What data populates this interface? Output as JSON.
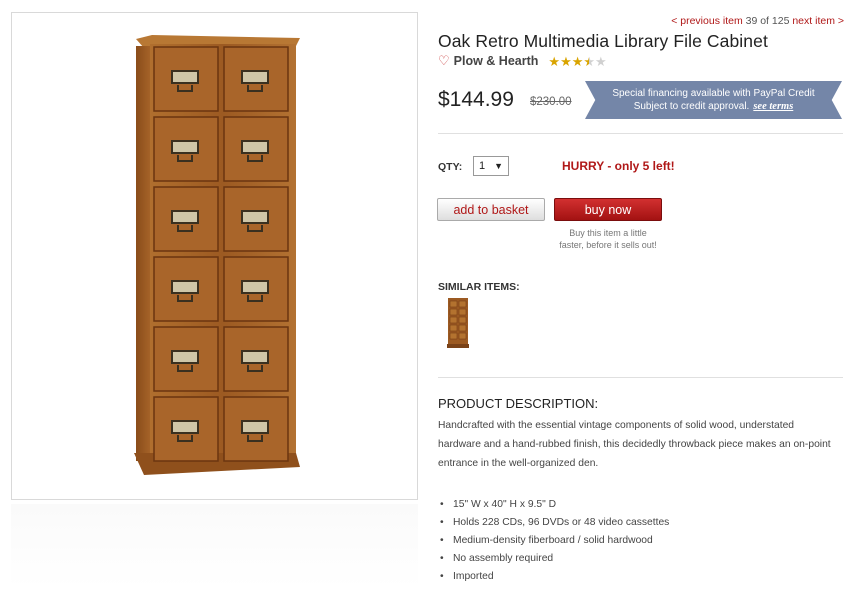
{
  "navigation": {
    "previous_label": "< previous item",
    "position_text": "39 of 125",
    "next_label": "next item >"
  },
  "product": {
    "title": "Oak Retro Multimedia Library File Cabinet",
    "brand": "Plow & Hearth",
    "rating": 3.5,
    "rating_max": 5,
    "price": "$144.99",
    "old_price": "$230.00"
  },
  "financing": {
    "line1": "Special financing available with PayPal Credit",
    "line2": "Subject to credit approval.",
    "link_label": "see terms",
    "color": "#7486a8"
  },
  "purchase": {
    "qty_label": "QTY:",
    "qty_value": "1",
    "hurry_text": "HURRY - only 5 left!",
    "add_to_basket_label": "add to basket",
    "buy_now_label": "buy now",
    "buy_now_note": "Buy this item a little faster, before it sells out!"
  },
  "similar": {
    "label": "SIMILAR ITEMS:"
  },
  "description": {
    "heading": "PRODUCT DESCRIPTION:",
    "text": "Handcrafted with the essential vintage components of solid wood, understated hardware and a hand-rubbed finish, this decidedly throwback piece makes an on-point entrance in the well-organized den.",
    "features": [
      "15\" W x 40\" H x 9.5\" D",
      "Holds 228 CDs, 96 DVDs or 48 video cassettes",
      "Medium-density fiberboard / solid hardwood",
      "No assembly required",
      "Imported"
    ]
  },
  "colors": {
    "accent_red": "#b01818",
    "star_gold": "#d9a400",
    "wood": "#a8662a"
  }
}
